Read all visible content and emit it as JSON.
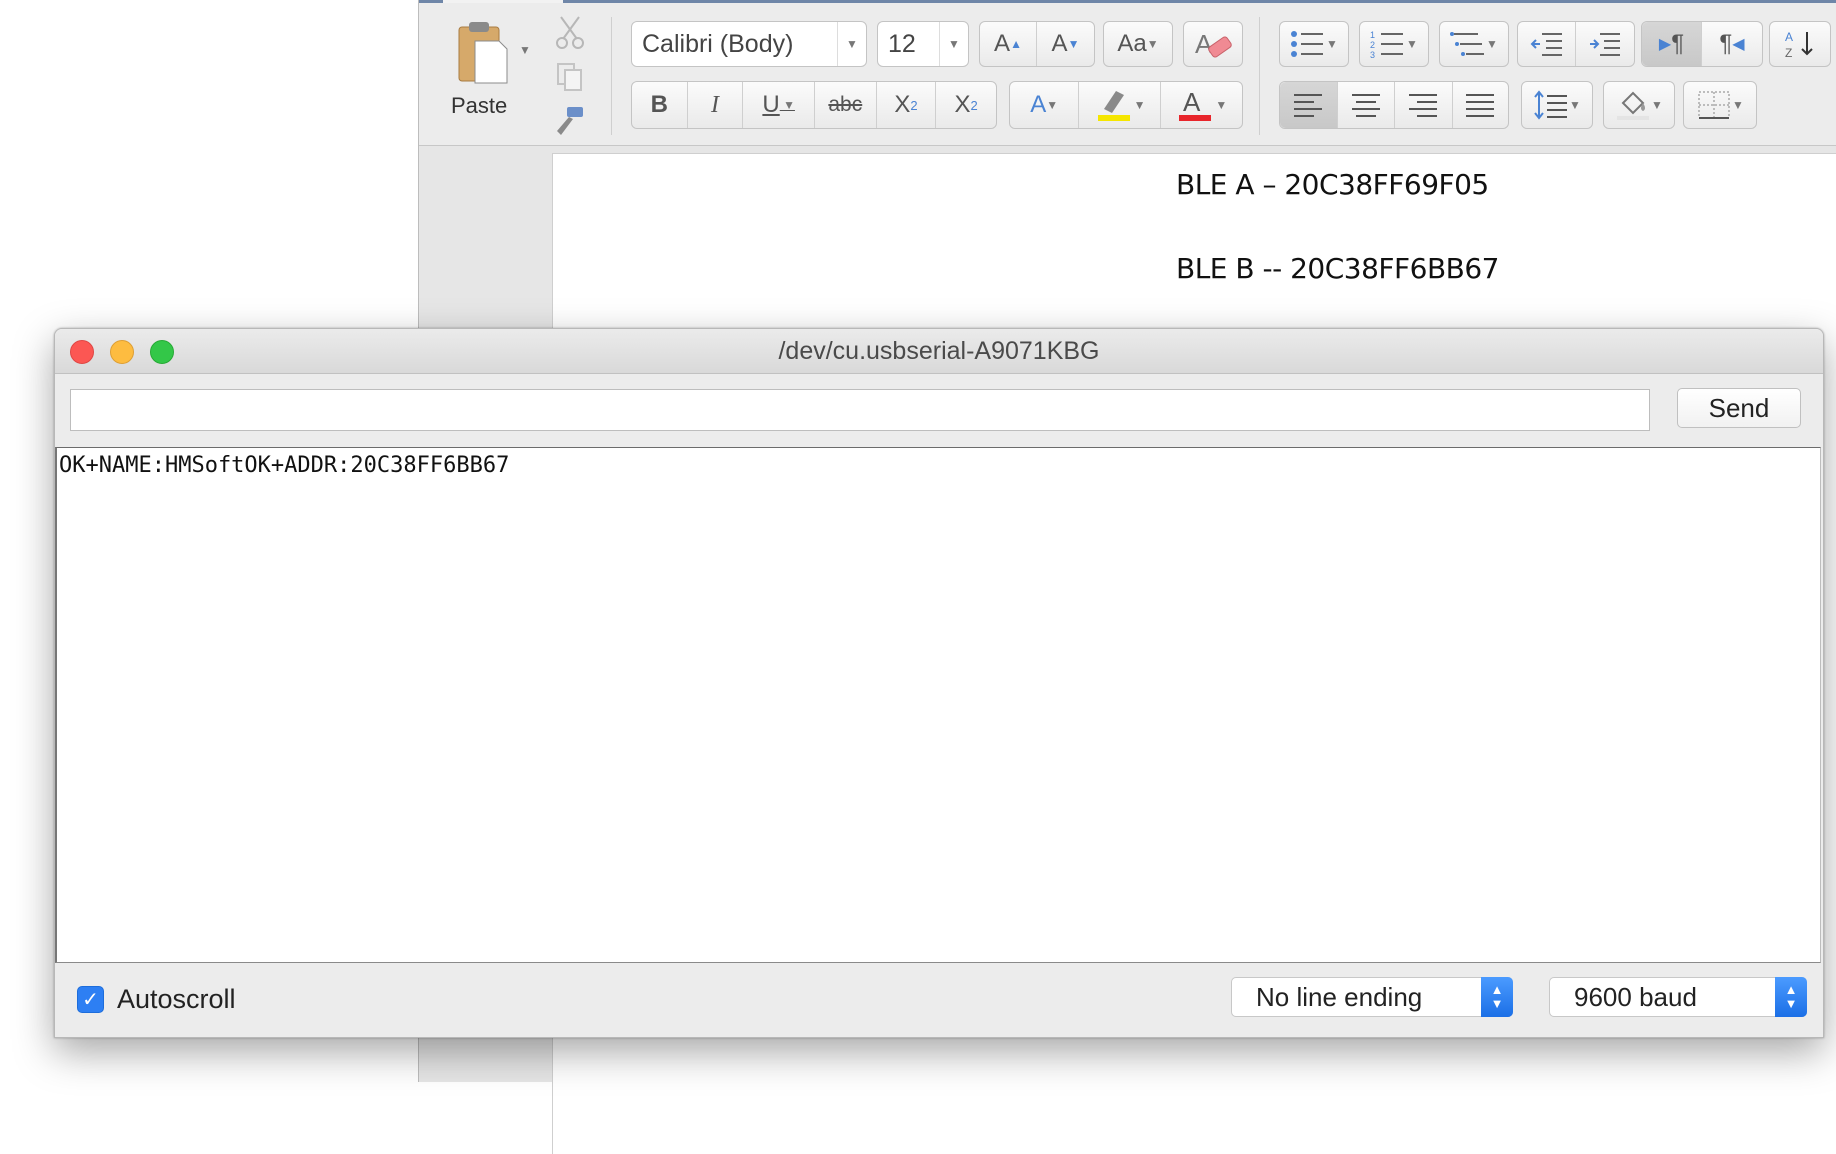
{
  "word": {
    "paste_label": "Paste",
    "font_name": "Calibri (Body)",
    "font_size": "12",
    "doc_lines": [
      "BLE A – 20C38FF69F05",
      "BLE B -- 20C38FF6BB67"
    ]
  },
  "serial": {
    "title": "/dev/cu.usbserial-A9071KBG",
    "input_value": "",
    "send_label": "Send",
    "output_text": "OK+NAME:HMSoftOK+ADDR:20C38FF6BB67",
    "autoscroll_label": "Autoscroll",
    "autoscroll_checked": true,
    "line_ending_selected": "No line ending",
    "baud_selected": "9600 baud"
  },
  "colors": {
    "accent_blue": "#2d7ff3",
    "close_red": "#fc5753",
    "minimize_yellow": "#fdbc40",
    "zoom_green": "#33c748",
    "font_color_red": "#e8252b",
    "highlight_yellow": "#f5e600"
  }
}
